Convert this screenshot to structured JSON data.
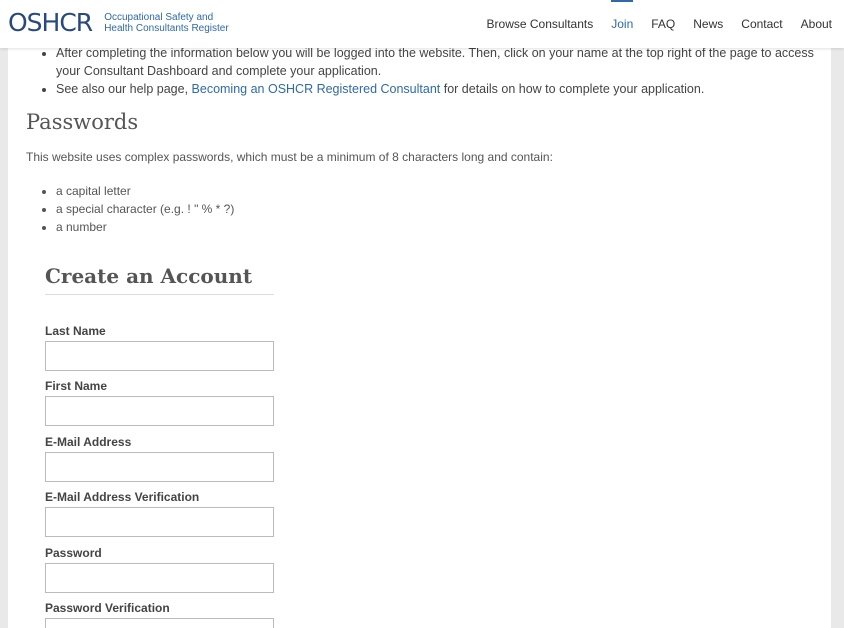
{
  "header": {
    "logo_mark": "OSHCR",
    "logo_line1": "Occupational Safety and",
    "logo_line2": "Health Consultants Register",
    "nav": [
      {
        "label": "Browse Consultants"
      },
      {
        "label": "Join"
      },
      {
        "label": "FAQ"
      },
      {
        "label": "News"
      },
      {
        "label": "Contact"
      },
      {
        "label": "About"
      }
    ]
  },
  "info": {
    "item1": "After completing the information below you will be logged into the website. Then, click on your name at the top right of the page to access your Consultant Dashboard and complete your application.",
    "item2_prefix": "See also our help page, ",
    "item2_link": "Becoming an OSHCR Registered Consultant",
    "item2_suffix": " for details on how to complete your application."
  },
  "passwords": {
    "heading": "Passwords",
    "intro": "This website uses complex passwords, which must be a minimum of 8 characters long and contain:",
    "rules": [
      "a capital letter",
      "a special character (e.g. ! \" % * ?)",
      "a number"
    ]
  },
  "form": {
    "title": "Create an Account",
    "fields": [
      {
        "label": "Last Name",
        "value": ""
      },
      {
        "label": "First Name",
        "value": ""
      },
      {
        "label": "E-Mail Address",
        "value": ""
      },
      {
        "label": "E-Mail Address Verification",
        "value": ""
      },
      {
        "label": "Password",
        "value": ""
      },
      {
        "label": "Password Verification",
        "value": ""
      }
    ]
  },
  "colors": {
    "brand": "#27497d",
    "link": "#2e6aa8"
  }
}
